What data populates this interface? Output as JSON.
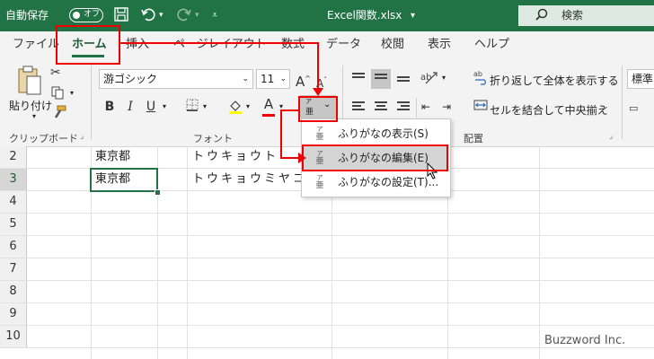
{
  "titlebar": {
    "autosave_label": "自動保存",
    "autosave_state": "オフ",
    "filename": "Excel関数.xlsx",
    "filename_caret": "▾",
    "search_placeholder": "検索",
    "bg_color": "#217346"
  },
  "tabs": [
    {
      "label": "ファイル"
    },
    {
      "label": "ホーム"
    },
    {
      "label": "挿入"
    },
    {
      "label": "ページレイアウト"
    },
    {
      "label": "数式"
    },
    {
      "label": "データ"
    },
    {
      "label": "校閲"
    },
    {
      "label": "表示"
    },
    {
      "label": "ヘルプ"
    }
  ],
  "ribbon": {
    "paste_label": "貼り付け",
    "clipboard_group": "クリップボード",
    "font_name": "游ゴシック",
    "font_size": "11",
    "font_group": "フォント",
    "bold": "B",
    "italic": "I",
    "underline": "U",
    "font_color_glyph": "A",
    "grow_font": "A",
    "shrink_font": "A",
    "furigana_top": "ア",
    "furigana_kanji": "亜",
    "wrap_text": "折り返して全体を表示する",
    "merge_center": "セルを結合して中央揃え",
    "alignment_group": "配置",
    "number_format": "標準"
  },
  "menu": {
    "items": [
      {
        "label": "ふりがなの表示(S)"
      },
      {
        "label": "ふりがなの編集(E)"
      },
      {
        "label": "ふりがなの設定(T)..."
      }
    ]
  },
  "sheet": {
    "rows": [
      {
        "num": "2",
        "b": "東京都",
        "c": "トウキョウト"
      },
      {
        "num": "3",
        "b": "東京都",
        "c": "トウキョウミヤコ"
      },
      {
        "num": "4",
        "b": "",
        "c": ""
      },
      {
        "num": "5",
        "b": "",
        "c": ""
      },
      {
        "num": "6",
        "b": "",
        "c": ""
      },
      {
        "num": "7",
        "b": "",
        "c": ""
      },
      {
        "num": "8",
        "b": "",
        "c": ""
      },
      {
        "num": "9",
        "b": "",
        "c": ""
      },
      {
        "num": "10",
        "b": "",
        "c": ""
      }
    ]
  },
  "watermark": "Buzzword Inc.",
  "colors": {
    "accent": "#217346",
    "annotation": "#e00000"
  }
}
